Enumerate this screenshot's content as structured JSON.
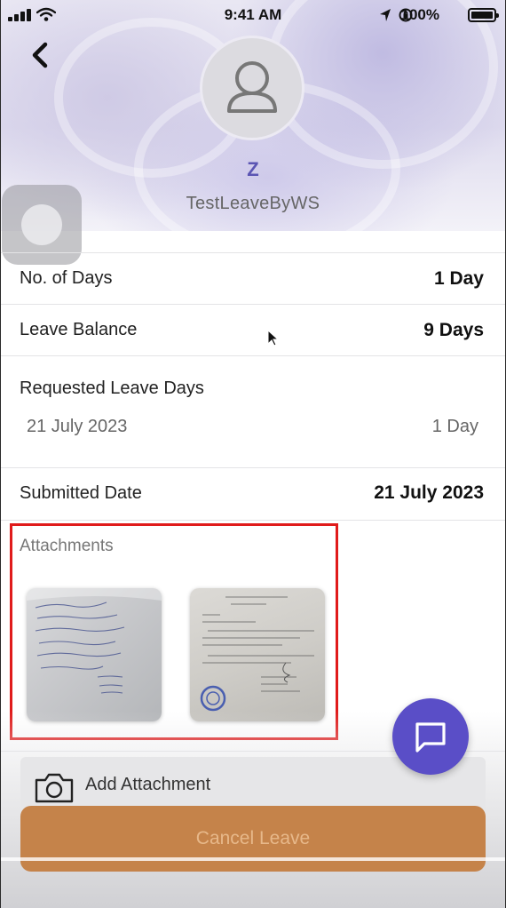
{
  "status_bar": {
    "time": "9:41 AM",
    "battery": "100%"
  },
  "profile": {
    "initial": "Z",
    "username": "TestLeaveByWS"
  },
  "details": {
    "no_of_days": {
      "label": "No. of Days",
      "value": "1 Day"
    },
    "leave_balance": {
      "label": "Leave Balance",
      "value": "9 Days"
    },
    "requested": {
      "label": "Requested Leave Days",
      "date": "21 July 2023",
      "days": "1 Day"
    },
    "submitted": {
      "label": "Submitted Date",
      "value": "21 July 2023"
    }
  },
  "attachments": {
    "label": "Attachments",
    "count": 2
  },
  "add_attachment": {
    "label": "Add Attachment"
  },
  "actions": {
    "cancel_label": "Cancel Leave"
  },
  "colors": {
    "accent": "#5a4ec7",
    "cancel_button": "#c5834a",
    "highlight_border": "#e01b1b"
  },
  "icons": [
    "back-chevron-icon",
    "user-icon",
    "camera-icon",
    "chat-icon",
    "signal-icon",
    "wifi-icon",
    "location-icon",
    "orientation-lock-icon",
    "battery-icon"
  ]
}
